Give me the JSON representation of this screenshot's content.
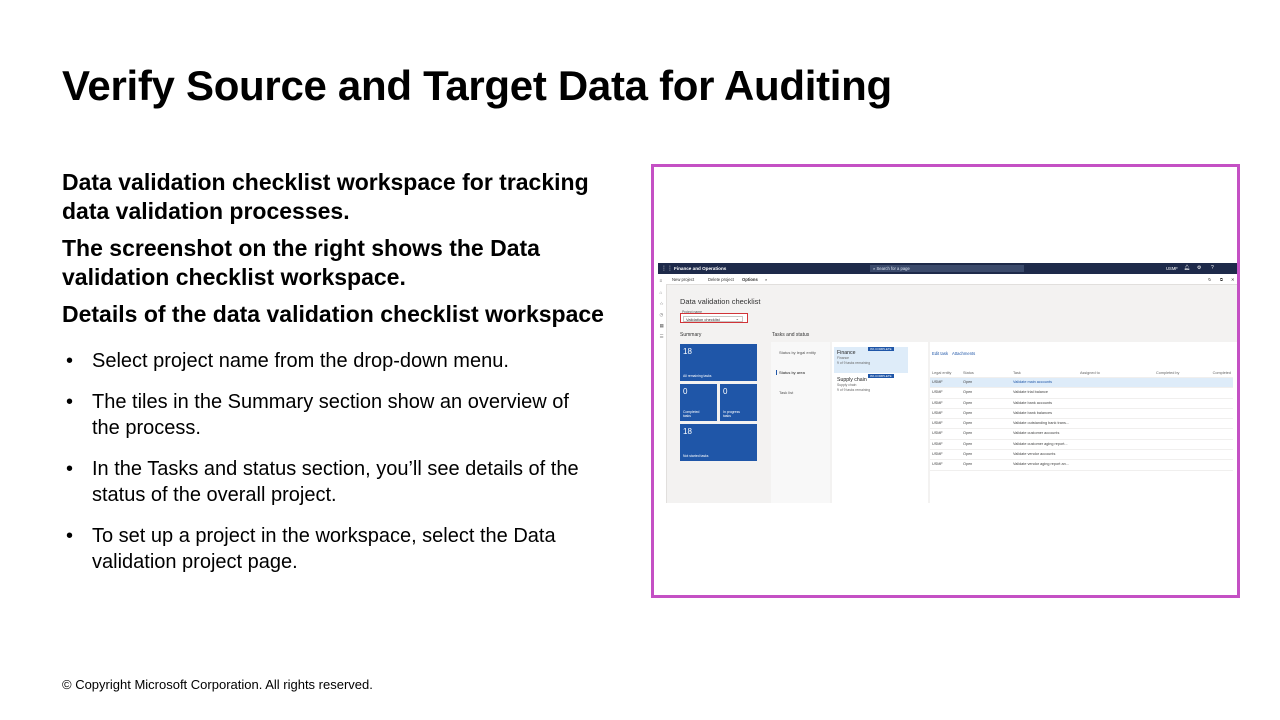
{
  "slide": {
    "title": "Verify Source and Target Data for Auditing",
    "lead": [
      "Data validation checklist workspace for tracking data validation processes.",
      "The screenshot on the right shows the Data validation checklist workspace.",
      "Details of the data validation checklist workspace"
    ],
    "bullets": [
      "Select project name from the drop-down menu.",
      "The tiles in the Summary section show an overview of the process.",
      "In the Tasks and status section, you’ll see details of the status of the overall project.",
      "To set up a project in the workspace, select the Data validation project page."
    ],
    "bullet_glyph": "•",
    "copyright": "© Copyright Microsoft Corporation. All rights reserved.",
    "frame_color": "#c450c4"
  },
  "app": {
    "brand": "Finance and Operations",
    "search_placeholder": "Search for a page",
    "company": "USMF",
    "toolbar": {
      "new_project": "New project",
      "delete_project": "Delete project",
      "options": "Options"
    },
    "workspace_title": "Data validation checklist",
    "project_name_label": "Project name",
    "project_name_value": "Validation checklist",
    "summary_title": "Summary",
    "tiles": [
      {
        "count": "18",
        "label": "All remaining tasks"
      },
      {
        "count": "0",
        "label": "Completed tasks"
      },
      {
        "count": "0",
        "label": "In progress tasks"
      },
      {
        "count": "18",
        "label": "Not started tasks"
      }
    ],
    "tasks_title": "Tasks and status",
    "status_tabs": [
      "Status by legal entity",
      "Status by area",
      "Task list"
    ],
    "areas": [
      {
        "name": "Finance",
        "sub1": "Finance",
        "sub2": "9 of 9 tasks remaining",
        "badge": "0% COMPLETE"
      },
      {
        "name": "Supply chain",
        "sub1": "Supply chain",
        "sub2": "9 of 9 tasks remaining",
        "badge": "0% COMPLETE"
      }
    ],
    "grid_links": [
      "Edit task",
      "Attachments"
    ],
    "grid_headers": [
      "Legal entity",
      "Status",
      "Task",
      "Assigned to",
      "Completed by",
      "Completed"
    ],
    "grid_rows": [
      {
        "entity": "USMF",
        "status": "Open",
        "task": "Validate main accounts"
      },
      {
        "entity": "USMF",
        "status": "Open",
        "task": "Validate trial balance"
      },
      {
        "entity": "USMF",
        "status": "Open",
        "task": "Validate bank accounts"
      },
      {
        "entity": "USMF",
        "status": "Open",
        "task": "Validate bank balances"
      },
      {
        "entity": "USMF",
        "status": "Open",
        "task": "Validate outstanding bank trans..."
      },
      {
        "entity": "USMF",
        "status": "Open",
        "task": "Validate customer accounts"
      },
      {
        "entity": "USMF",
        "status": "Open",
        "task": "Validate customer aging report..."
      },
      {
        "entity": "USMF",
        "status": "Open",
        "task": "Validate vendor accounts"
      },
      {
        "entity": "USMF",
        "status": "Open",
        "task": "Validate vendor aging report an..."
      }
    ]
  }
}
